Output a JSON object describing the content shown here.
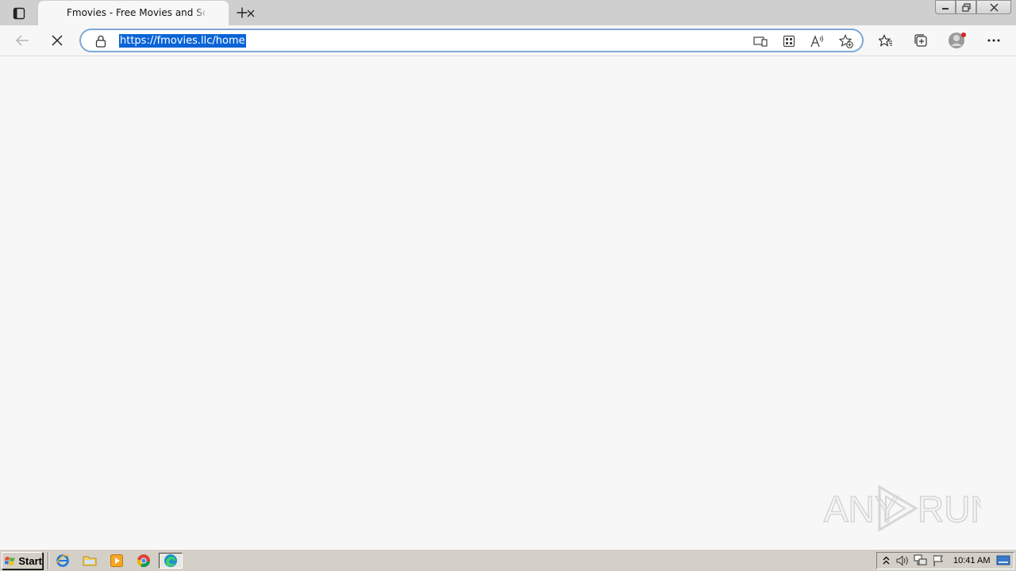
{
  "browser": {
    "tab": {
      "title": "Fmovies - Free Movies and Series"
    },
    "address": {
      "url": "https://fmovies.llc/home"
    }
  },
  "watermark": {
    "text": "ANY RUN"
  },
  "taskbar": {
    "start_label": "Start",
    "clock": "10:41 AM"
  },
  "colors": {
    "accent": "#0a64d6",
    "address_border": "#7da8d6",
    "page_background": "#f7f7f7",
    "taskbar": "#d4d0c8"
  },
  "icons": {
    "tab_actions": "tab-actions-icon",
    "tab_close": "close-icon",
    "new_tab": "plus-icon",
    "back": "back-arrow-icon",
    "stop": "stop-icon",
    "lock": "lock-icon",
    "app_available": "app-available-icon",
    "extensions": "extensions-grid-icon",
    "read_aloud": "read-aloud-icon",
    "add_favorite": "add-favorite-icon",
    "favorites": "favorites-icon",
    "collections": "collections-icon",
    "profile": "profile-avatar-icon",
    "menu": "more-menu-icon"
  }
}
